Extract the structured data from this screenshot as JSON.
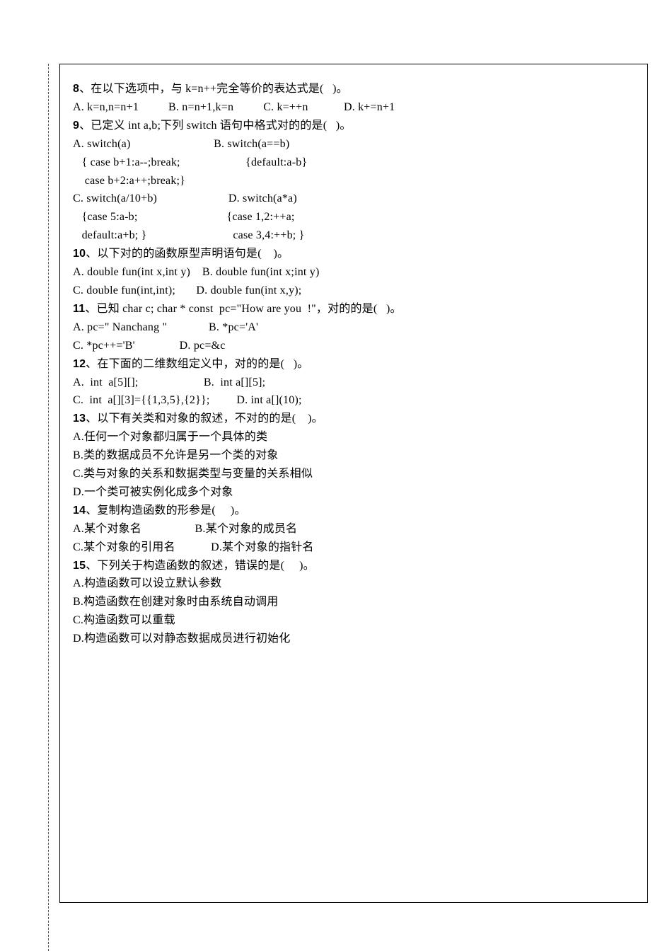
{
  "q8": {
    "num": "8",
    "head": "、在以下选项中，与 k=n++完全等价的表达式是(   )。",
    "optA": "A. k=n,n=n+1",
    "optB": "B. n=n+1,k=n",
    "optC": "C. k=++n",
    "optD": "D. k+=n+1"
  },
  "q9": {
    "num": "9",
    "head": "、已定义 int a,b;下列 switch 语句中格式对的的是(   )。",
    "a1": "A. switch(a)",
    "b1": "B. switch(a==b)",
    "a2": "   { case b+1:a--;break;",
    "b2": "{default:a-b}",
    "a3": "    case b+2:a++;break;}",
    "c1": "C. switch(a/10+b)",
    "d1": "D. switch(a*a)",
    "c2": "   {case 5:a-b;",
    "d2": "{case 1,2:++a;",
    "c3": "   default:a+b; }",
    "d3": " case 3,4:++b; }"
  },
  "q10": {
    "num": "10",
    "head": "、以下对的的函数原型声明语句是(    )。",
    "l1": "A. double fun(int x,int y)    B. double fun(int x;int y)",
    "l2": "C. double fun(int,int);       D. double fun(int x,y);"
  },
  "q11": {
    "num": "11",
    "head": "、已知 char c; char * const  pc=\"How are you  !\"，对的的是(   )。",
    "l1": "A. pc=\" Nanchang \"              B. *pc='A'",
    "l2": "C. *pc++='B'               D. pc=&c"
  },
  "q12": {
    "num": "12",
    "head": "、在下面的二维数组定义中，对的的是(   )。",
    "l1": "A.  int  a[5][];                      B.  int a[][5];",
    "l2": "C.  int  a[][3]={{1,3,5},{2}};         D. int a[](10);"
  },
  "q13": {
    "num": "13",
    "head": "、以下有关类和对象的叙述，不对的的是(    )。",
    "a": "A.任何一个对象都归属于一个具体的类",
    "b": "B.类的数据成员不允许是另一个类的对象",
    "c": "C.类与对象的关系和数据类型与变量的关系相似",
    "d": "D.一个类可被实例化成多个对象"
  },
  "q14": {
    "num": "14",
    "head": "、复制构造函数的形参是(     )。",
    "l1": "A.某个对象名                  B.某个对象的成员名",
    "l2": "C.某个对象的引用名            D.某个对象的指针名"
  },
  "q15": {
    "num": "15",
    "head": "、下列关于构造函数的叙述，错误的是(     )。",
    "a": "A.构造函数可以设立默认参数",
    "b": "B.构造函数在创建对象时由系统自动调用",
    "c": "C.构造函数可以重载",
    "d": "D.构造函数可以对静态数据成员进行初始化"
  }
}
